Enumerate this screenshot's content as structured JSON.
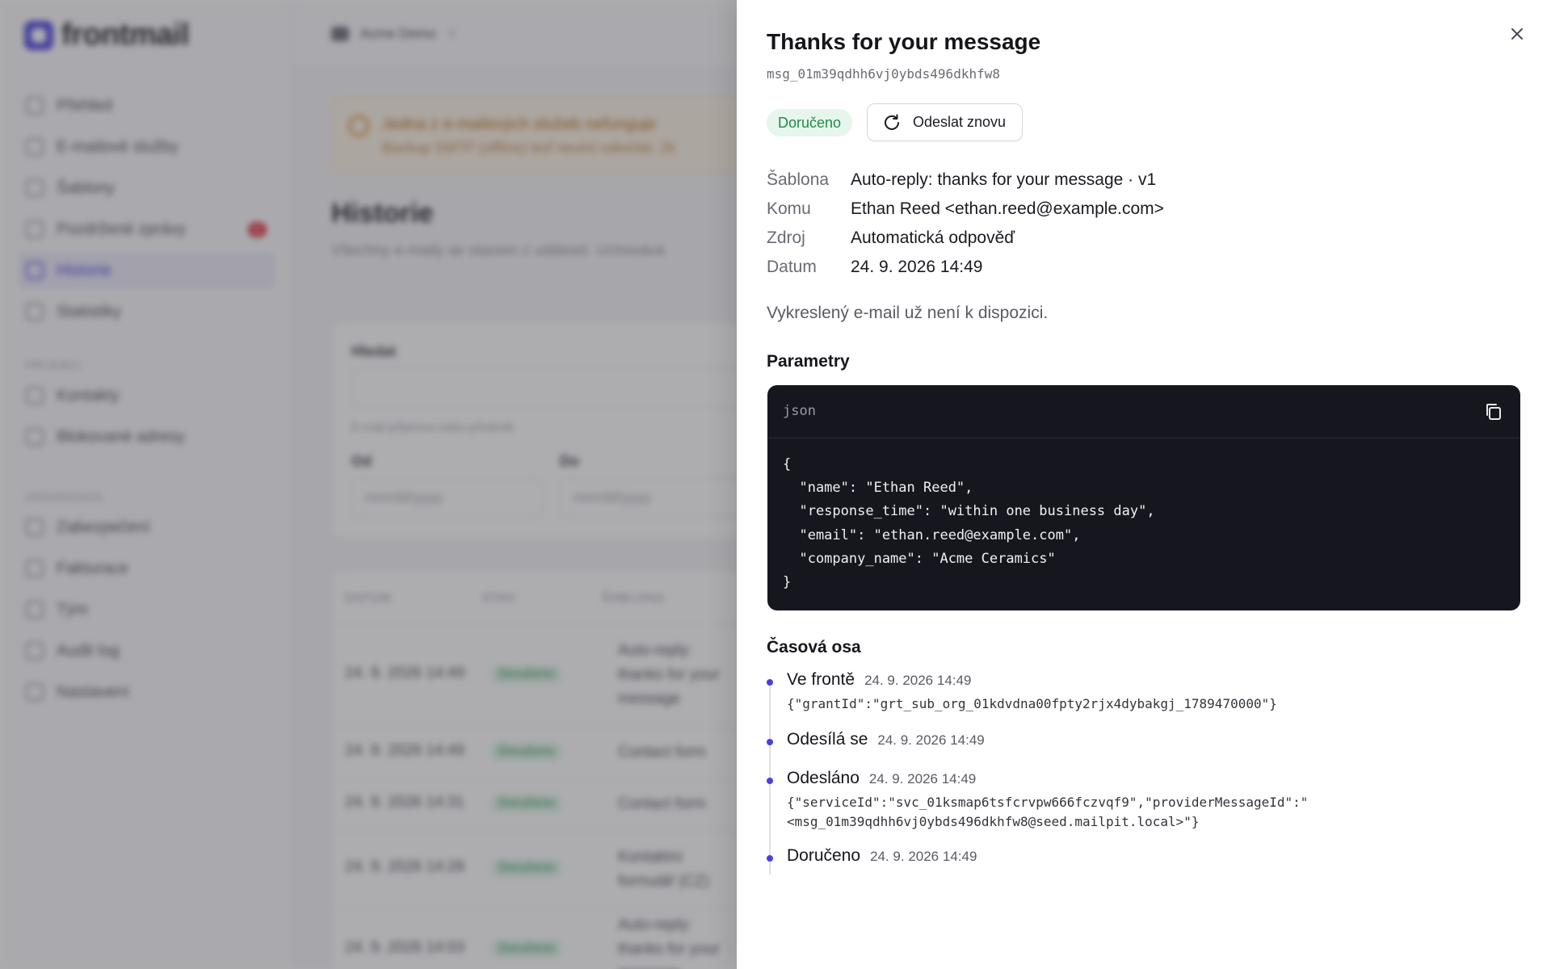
{
  "app": {
    "brand": "frontmail",
    "org_name": "Acme Demo",
    "nav": [
      {
        "label": "Přehled"
      },
      {
        "label": "E-mailové služby"
      },
      {
        "label": "Šablony"
      },
      {
        "label": "Pozdržené zprávy",
        "badge": "6"
      },
      {
        "label": "Historie",
        "active": true
      },
      {
        "label": "Statistiky"
      }
    ],
    "nav_section_recipients": "PŘÍJEMCI",
    "nav_recipients": [
      {
        "label": "Kontakty"
      },
      {
        "label": "Blokované adresy"
      }
    ],
    "nav_section_org": "ORGANIZACE",
    "nav_org": [
      {
        "label": "Zabezpečení"
      },
      {
        "label": "Fakturace"
      },
      {
        "label": "Tým"
      },
      {
        "label": "Audit log"
      },
      {
        "label": "Nastavení"
      }
    ],
    "alert": {
      "title": "Jedna z e-mailových služeb nefunguje",
      "text": "Backup SMTP (offline) teď neumí odesílat. Zk"
    },
    "page_title": "Historie",
    "page_subtitle": "Všechny e-maily se stavem z událostí. Uchovává",
    "filters": {
      "search_label": "Hledat",
      "search_hint": "E-mail příjemce nebo předmět",
      "from_label": "Od",
      "to_label": "Do",
      "date_placeholder": "mm/dd/yyyy"
    },
    "table": {
      "headers": [
        "DATUM",
        "STAV",
        "ŠABLONA"
      ],
      "rows": [
        {
          "date": "24. 9. 2026 14:49",
          "status": "Doručeno",
          "template": "Auto-reply: thanks for your message"
        },
        {
          "date": "24. 9. 2026 14:49",
          "status": "Doručeno",
          "template": "Contact form"
        },
        {
          "date": "24. 9. 2026 14:31",
          "status": "Doručeno",
          "template": "Contact form"
        },
        {
          "date": "24. 9. 2026 14:28",
          "status": "Doručeno",
          "template": "Kontaktní formulář (CZ)"
        },
        {
          "date": "24. 9. 2026 14:03",
          "status": "Doručeno",
          "template": "Auto-reply: thanks for your message"
        }
      ]
    }
  },
  "drawer": {
    "title": "Thanks for your message",
    "message_id": "msg_01m39qdhh6vj0ybds496dkhfw8",
    "status": "Doručeno",
    "resend_label": "Odeslat znovu",
    "meta": [
      {
        "key": "Šablona",
        "value": "Auto-reply: thanks for your message · v1"
      },
      {
        "key": "Komu",
        "value": "Ethan Reed <ethan.reed@example.com>"
      },
      {
        "key": "Zdroj",
        "value": "Automatická odpověď"
      },
      {
        "key": "Datum",
        "value": "24. 9. 2026 14:49"
      }
    ],
    "render_note": "Vykreslený e-mail už není k dispozici.",
    "params_heading": "Parametry",
    "code_lang": "json",
    "code": "{\n  \"name\": \"Ethan Reed\",\n  \"response_time\": \"within one business day\",\n  \"email\": \"ethan.reed@example.com\",\n  \"company_name\": \"Acme Ceramics\"\n}",
    "timeline_heading": "Časová osa",
    "timeline": [
      {
        "label": "Ve frontě",
        "time": "24. 9. 2026 14:49",
        "detail": "{\"grantId\":\"grt_sub_org_01kdvdna00fpty2rjx4dybakgj_1789470000\"}"
      },
      {
        "label": "Odesílá se",
        "time": "24. 9. 2026 14:49",
        "detail": ""
      },
      {
        "label": "Odesláno",
        "time": "24. 9. 2026 14:49",
        "detail": "{\"serviceId\":\"svc_01ksmap6tsfcrvpw666fczvqf9\",\"providerMessageId\":\"\n<msg_01m39qdhh6vj0ybds496dkhfw8@seed.mailpit.local>\"}"
      },
      {
        "label": "Doručeno",
        "time": "24. 9. 2026 14:49",
        "detail": ""
      }
    ]
  },
  "colors": {
    "accent": "#4b3fe0",
    "success": "#1f8a4c",
    "success_bg": "#e6f6ec",
    "code_bg": "#16161e",
    "overlay": "rgba(60,60,66,0.42)"
  },
  "icons": {
    "close": "x-icon",
    "resend": "refresh-icon",
    "copy": "copy-icon"
  }
}
